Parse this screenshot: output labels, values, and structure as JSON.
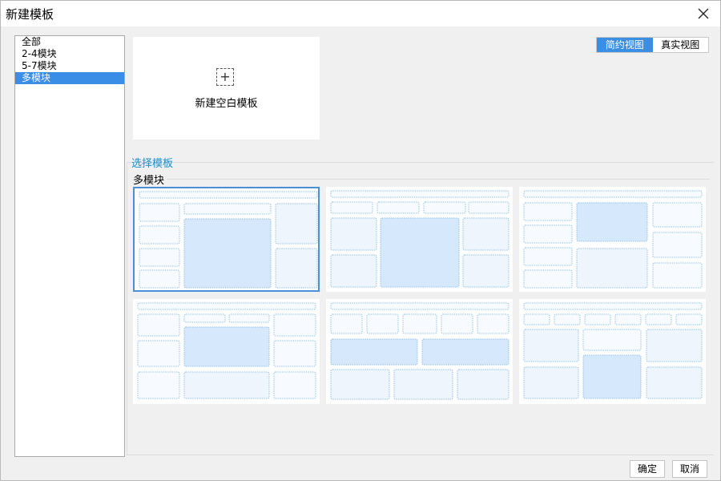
{
  "window": {
    "title": "新建模板"
  },
  "sidebar": {
    "items": [
      {
        "label": "全部",
        "selected": false
      },
      {
        "label": "2-4模块",
        "selected": false
      },
      {
        "label": "5-7模块",
        "selected": false
      },
      {
        "label": "多模块",
        "selected": true
      }
    ]
  },
  "blank": {
    "plus": "+",
    "label": "新建空白模板"
  },
  "view_toggle": {
    "simple": "简约视图",
    "real": "真实视图",
    "active": "simple"
  },
  "section": {
    "title": "选择模板",
    "group": "多模块"
  },
  "templates": [
    {
      "name": "template-1",
      "selected": true
    },
    {
      "name": "template-2",
      "selected": false
    },
    {
      "name": "template-3",
      "selected": false
    },
    {
      "name": "template-4",
      "selected": false
    },
    {
      "name": "template-5",
      "selected": false
    },
    {
      "name": "template-6",
      "selected": false
    }
  ],
  "footer": {
    "ok": "确定",
    "cancel": "取消"
  },
  "colors": {
    "accent": "#3a8ee6",
    "section_title": "#1a8dcc",
    "block_border": "#8fc1ee",
    "block_fill_light": "#f3f8fe",
    "block_fill_strong": "#d6e8fb"
  }
}
